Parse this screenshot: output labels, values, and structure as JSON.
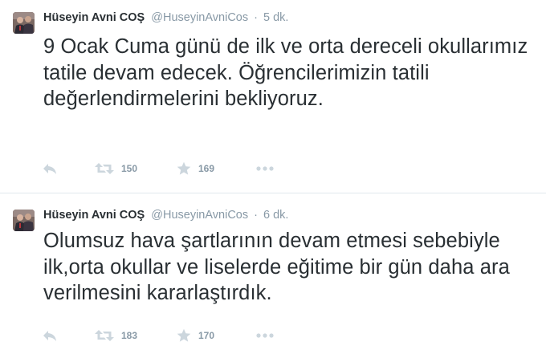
{
  "tweets": [
    {
      "fullname": "Hüseyin Avni COŞ",
      "screen_name": "@HuseyinAvniCos",
      "separator": "·",
      "time": "5 dk.",
      "text": "9 Ocak Cuma günü de ilk ve orta dereceli okullarımız tatile devam edecek. Öğrencilerimizin tatili değerlendirmelerini bekliyoruz.",
      "actions": {
        "reply_icon": "reply-icon",
        "retweet_icon": "retweet-icon",
        "retweet_count": "150",
        "favorite_icon": "star-icon",
        "favorite_count": "169",
        "more_icon": "more-dots-icon"
      }
    },
    {
      "fullname": "Hüseyin Avni COŞ",
      "screen_name": "@HuseyinAvniCos",
      "separator": "·",
      "time": "6 dk.",
      "text": "Olumsuz hava şartlarının devam etmesi sebebiyle ilk,orta okullar ve liselerde eğitime bir gün daha ara verilmesini kararlaştırdık.",
      "actions": {
        "reply_icon": "reply-icon",
        "retweet_icon": "retweet-icon",
        "retweet_count": "183",
        "favorite_icon": "star-icon",
        "favorite_count": "170",
        "more_icon": "more-dots-icon"
      }
    }
  ],
  "colors": {
    "text": "#292f33",
    "muted": "#8899a6",
    "icon": "#ccd6dd",
    "divider": "#e1e8ed"
  }
}
